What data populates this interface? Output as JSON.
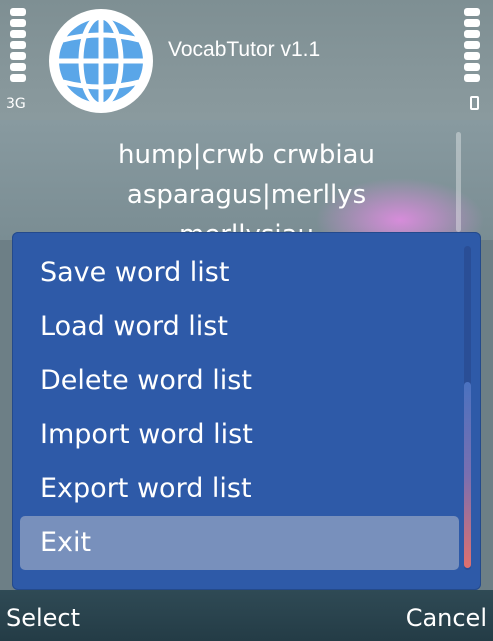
{
  "status": {
    "network": "3G",
    "signal_bars": 7,
    "battery_icon": "battery-icon"
  },
  "app": {
    "title": "VocabTutor v1.1",
    "logo_icon": "globe-icon"
  },
  "words": [
    "hump|crwb crwbiau",
    "asparagus|merllys",
    "merllysiau"
  ],
  "menu": {
    "items": [
      {
        "label": "Save word list",
        "selected": false
      },
      {
        "label": "Load word list",
        "selected": false
      },
      {
        "label": "Delete word list",
        "selected": false
      },
      {
        "label": "Import word list",
        "selected": false
      },
      {
        "label": "Export word list",
        "selected": false
      },
      {
        "label": "Exit",
        "selected": true
      }
    ]
  },
  "softkeys": {
    "left": "Select",
    "right": "Cancel"
  },
  "colors": {
    "menu_bg": "#2e5aa8",
    "menu_selected": "#7890bc",
    "softkey_bg": "#243c46"
  }
}
